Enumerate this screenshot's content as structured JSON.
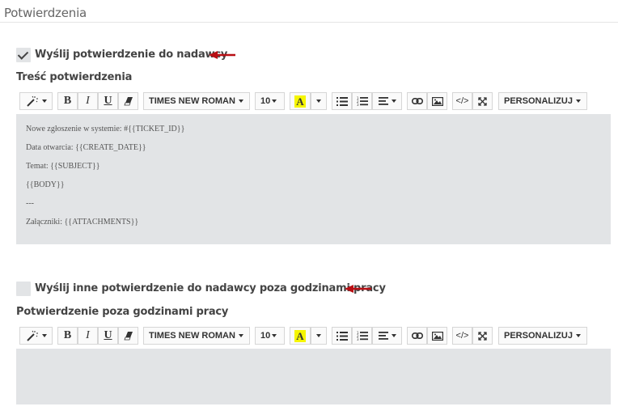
{
  "header": {
    "title": "Potwierdzenia"
  },
  "confirmation": {
    "checkbox_label": "Wyślij potwierdzenie do nadawcy",
    "checked": true,
    "section_label": "Treść potwierdzenia",
    "editor_lines": [
      "Nowe zgłoszenie w systemie: #{{TICKET_ID}}",
      "Data otwarcia: {{CREATE_DATE}}",
      "Temat: {{SUBJECT}}",
      "{{BODY}}",
      "---",
      "Załączniki: {{ATTACHMENTS}}"
    ]
  },
  "after_hours": {
    "checkbox_label": "Wyślij inne potwierdzenie do nadawcy poza godzinami pracy",
    "checked": false,
    "section_label": "Potwierdzenie poza godzinami pracy"
  },
  "toolbar": {
    "font_family": "TIMES NEW ROMAN",
    "font_size": "10",
    "color_letter": "A",
    "personalize_label": "PERSONALIZUJ",
    "bold_label": "B",
    "italic_label": "I",
    "underline_label": "U",
    "code_label": "</>"
  },
  "colors": {
    "arrow": "#b80f14",
    "editor_bg": "#e2e4e6",
    "highlight": "#f5f500"
  },
  "icons": [
    "magic-wand-icon",
    "eraser-icon",
    "bullet-list-icon",
    "numbered-list-icon",
    "align-icon",
    "link-icon",
    "image-icon",
    "code-view-icon",
    "fullscreen-icon"
  ]
}
